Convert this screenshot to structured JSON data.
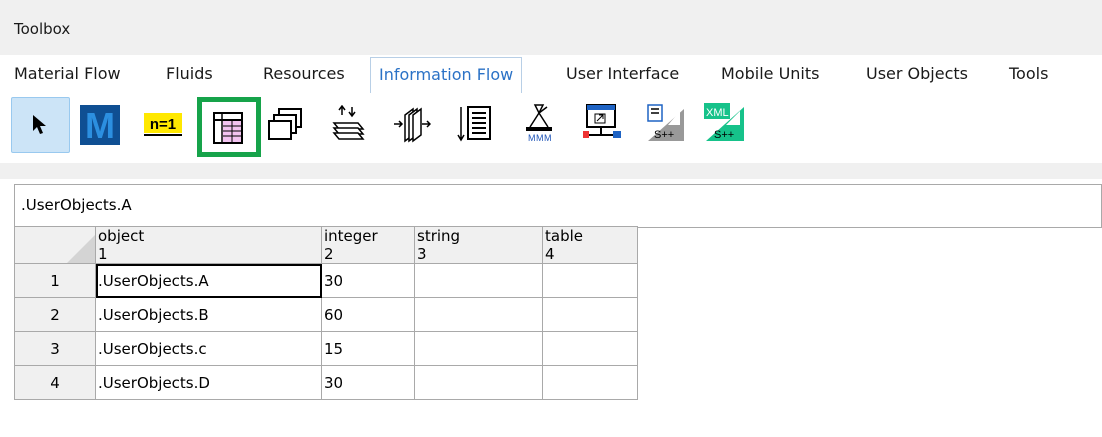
{
  "toolbox": {
    "title": "Toolbox"
  },
  "tabs": [
    {
      "label": "Material Flow"
    },
    {
      "label": "Fluids"
    },
    {
      "label": "Resources"
    },
    {
      "label": "Information Flow",
      "active": true
    },
    {
      "label": "User Interface"
    },
    {
      "label": "Mobile Units"
    },
    {
      "label": "User Objects"
    },
    {
      "label": "Tools"
    }
  ],
  "tools": [
    {
      "icon": "pointer-icon",
      "selected": true
    },
    {
      "icon": "method-icon",
      "label": "M"
    },
    {
      "icon": "variable-icon",
      "label": "n=1"
    },
    {
      "icon": "table-file-icon",
      "highlighted": true
    },
    {
      "icon": "stack-icon"
    },
    {
      "icon": "queue-file-icon"
    },
    {
      "icon": "card-file-icon"
    },
    {
      "icon": "trigger-icon"
    },
    {
      "icon": "generator-icon"
    },
    {
      "icon": "interface-icon"
    },
    {
      "icon": "socket-icon"
    },
    {
      "icon": "cpp-interface-icon",
      "label": "S++"
    },
    {
      "icon": "xml-interface-icon",
      "label": "XML S++"
    }
  ],
  "accent_color": "#2b72c6",
  "highlight_color": "#16a34a",
  "table": {
    "path": ".UserObjects.A",
    "columns": [
      {
        "name": "object",
        "index": "1"
      },
      {
        "name": "integer",
        "index": "2"
      },
      {
        "name": "string",
        "index": "3"
      },
      {
        "name": "table",
        "index": "4"
      }
    ],
    "rows": [
      {
        "num": "1",
        "object": ".UserObjects.A",
        "integer": "30",
        "string": "",
        "table": ""
      },
      {
        "num": "2",
        "object": ".UserObjects.B",
        "integer": "60",
        "string": "",
        "table": ""
      },
      {
        "num": "3",
        "object": ".UserObjects.c",
        "integer": "15",
        "string": "",
        "table": ""
      },
      {
        "num": "4",
        "object": ".UserObjects.D",
        "integer": "30",
        "string": "",
        "table": ""
      }
    ]
  }
}
